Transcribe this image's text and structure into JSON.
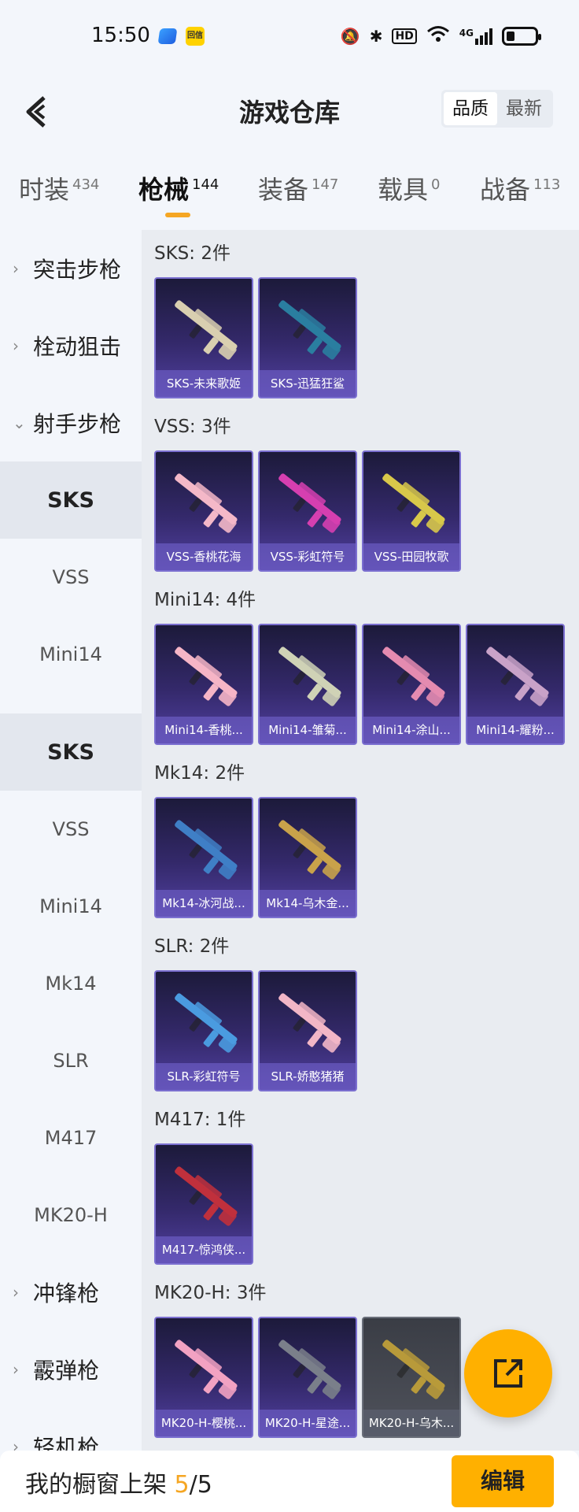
{
  "status_bar": {
    "time": "15:50",
    "app_badge": "回信",
    "hd": "HD",
    "net": "4G"
  },
  "header": {
    "title": "游戏仓库",
    "sort_options": [
      "品质",
      "最新"
    ],
    "sort_active": "品质"
  },
  "tabs": [
    {
      "label": "时装",
      "count": "434"
    },
    {
      "label": "枪械",
      "count": "144"
    },
    {
      "label": "装备",
      "count": "147"
    },
    {
      "label": "载具",
      "count": "0"
    },
    {
      "label": "战备",
      "count": "113"
    }
  ],
  "sidebar": {
    "cat_assault": "突击步枪",
    "cat_bolt": "栓动狙击",
    "cat_marksman": "射手步枪",
    "sub_a": [
      "SKS",
      "VSS",
      "Mini14"
    ],
    "sub_b": [
      "SKS",
      "VSS",
      "Mini14",
      "Mk14",
      "SLR",
      "M417",
      "MK20-H"
    ],
    "cat_smg": "冲锋枪",
    "cat_shotgun": "霰弹枪",
    "cat_lmg": "轻机枪"
  },
  "groups": [
    {
      "title": "SKS: 2件",
      "items": [
        "SKS-未来歌姬",
        "SKS-迅猛狂鲨"
      ]
    },
    {
      "title": "VSS: 3件",
      "items": [
        "VSS-香桃花海",
        "VSS-彩虹符号",
        "VSS-田园牧歌"
      ]
    },
    {
      "title": "Mini14: 4件",
      "items": [
        "Mini14-香桃...",
        "Mini14-雏菊...",
        "Mini14-涂山...",
        "Mini14-耀粉..."
      ]
    },
    {
      "title": "Mk14: 2件",
      "items": [
        "Mk14-冰河战...",
        "Mk14-乌木金..."
      ]
    },
    {
      "title": "SLR: 2件",
      "items": [
        "SLR-彩虹符号",
        "SLR-娇憨猪猪"
      ]
    },
    {
      "title": "M417: 1件",
      "items": [
        "M417-惊鸿侠..."
      ]
    },
    {
      "title": "MK20-H: 3件",
      "items": [
        "MK20-H-樱桃...",
        "MK20-H-星途...",
        "MK20-H-乌木..."
      ]
    }
  ],
  "gun_colors": {
    "sks1": "#d9cfb0",
    "sks2": "#2a7ea0",
    "vss1": "#f4b8c8",
    "vss2": "#d63fb0",
    "vss3": "#d8c84a",
    "mini1": "#f6b5c6",
    "mini2": "#cfd2b6",
    "mini3": "#e48bb0",
    "mini4": "#c9a2c8",
    "mk1": "#3f7fc6",
    "mk2": "#c9a24a",
    "slr1": "#4a9be0",
    "slr2": "#f2b6c6",
    "m417": "#c0303c",
    "mk20a": "#f2a2c2",
    "mk20b": "#7a7f8a",
    "mk20c": "#b89a3a"
  },
  "fab": {
    "icon": "share-icon"
  },
  "bottom": {
    "label": "我的橱窗上架",
    "count": "5",
    "sep": "/",
    "total": "5",
    "edit": "编辑"
  }
}
